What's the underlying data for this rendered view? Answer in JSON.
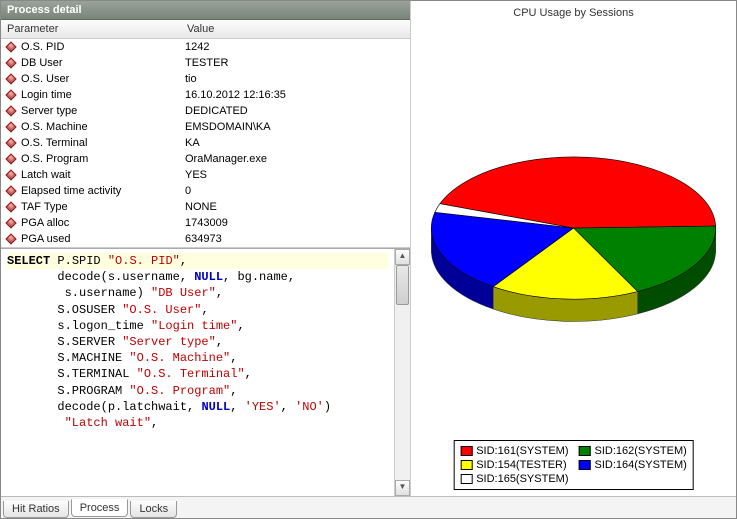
{
  "panel": {
    "title": "Process detail",
    "col_param": "Parameter",
    "col_value": "Value"
  },
  "rows": [
    {
      "param": "O.S. PID",
      "value": "1242"
    },
    {
      "param": "DB User",
      "value": "TESTER"
    },
    {
      "param": "O.S. User",
      "value": "tio"
    },
    {
      "param": "Login time",
      "value": "16.10.2012 12:16:35"
    },
    {
      "param": "Server type",
      "value": "DEDICATED"
    },
    {
      "param": "O.S. Machine",
      "value": "EMSDOMAIN\\KA"
    },
    {
      "param": "O.S. Terminal",
      "value": "KA"
    },
    {
      "param": "O.S. Program",
      "value": "OraManager.exe"
    },
    {
      "param": "Latch wait",
      "value": "YES"
    },
    {
      "param": "Elapsed time activity",
      "value": "0"
    },
    {
      "param": "TAF Type",
      "value": "NONE"
    },
    {
      "param": "PGA alloc",
      "value": "1743009"
    },
    {
      "param": "PGA used",
      "value": "634973"
    }
  ],
  "sql": {
    "l1_kw": "SELECT ",
    "l1_rest": "P.SPID ",
    "l1_str": "\"O.S. PID\"",
    "l1_end": ",",
    "l2a": "       decode(s.username, ",
    "l2b": "NULL",
    "l2c": ", bg.name,",
    "l3a": "        s.username) ",
    "l3b": "\"DB User\"",
    "l3c": ",",
    "l4a": "       S.OSUSER ",
    "l4b": "\"O.S. User\"",
    "l4c": ",",
    "l5a": "       s.logon_time ",
    "l5b": "\"Login time\"",
    "l5c": ",",
    "l6a": "       S.SERVER ",
    "l6b": "\"Server type\"",
    "l6c": ",",
    "l7a": "       S.MACHINE ",
    "l7b": "\"O.S. Machine\"",
    "l7c": ",",
    "l8a": "       S.TERMINAL ",
    "l8b": "\"O.S. Terminal\"",
    "l8c": ",",
    "l9a": "       S.PROGRAM ",
    "l9b": "\"O.S. Program\"",
    "l9c": ",",
    "l10a": "       decode(p.latchwait, ",
    "l10b": "NULL",
    "l10c": ", ",
    "l10d": "'YES'",
    "l10e": ", ",
    "l10f": "'NO'",
    "l10g": ")",
    "l11a": "        ",
    "l11b": "\"Latch wait\"",
    "l11c": ","
  },
  "tabs": {
    "t1": "Hit Ratios",
    "t2": "Process",
    "t3": "Locks"
  },
  "chart": {
    "title": "CPU Usage by Sessions"
  },
  "chart_data": {
    "type": "pie",
    "title": "CPU Usage by Sessions",
    "series": [
      {
        "name": "SID:161(SYSTEM)",
        "value": 44,
        "color": "#ff0000"
      },
      {
        "name": "SID:162(SYSTEM)",
        "value": 18,
        "color": "#008000"
      },
      {
        "name": "SID:154(TESTER)",
        "value": 17,
        "color": "#ffff00"
      },
      {
        "name": "SID:164(SYSTEM)",
        "value": 19,
        "color": "#0000ff"
      },
      {
        "name": "SID:165(SYSTEM)",
        "value": 2,
        "color": "#ffffff"
      }
    ]
  },
  "legend": {
    "i0": "SID:161(SYSTEM)",
    "i1": "SID:162(SYSTEM)",
    "i2": "SID:154(TESTER)",
    "i3": "SID:164(SYSTEM)",
    "i4": "SID:165(SYSTEM)"
  }
}
